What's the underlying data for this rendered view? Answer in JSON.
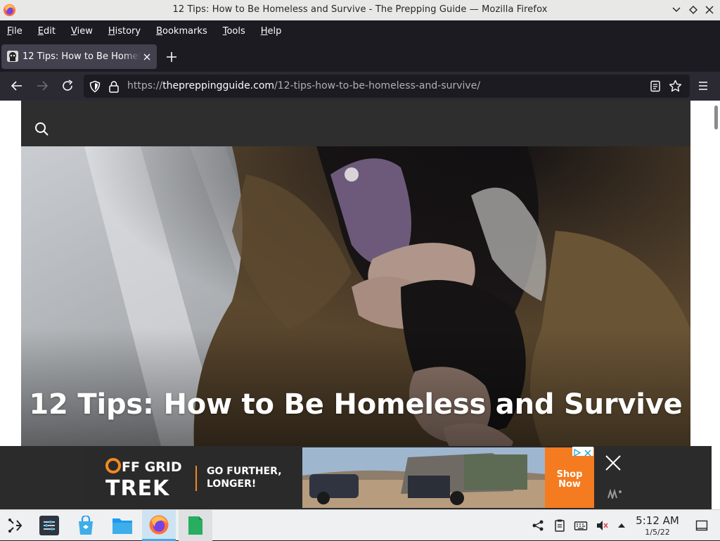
{
  "window": {
    "title": "12 Tips: How to Be Homeless and Survive - The Prepping Guide — Mozilla Firefox"
  },
  "menubar": {
    "items": [
      "File",
      "Edit",
      "View",
      "History",
      "Bookmarks",
      "Tools",
      "Help"
    ]
  },
  "tab": {
    "title": "12 Tips: How to Be Homeless and Survive - The Prepping Guide"
  },
  "urlbar": {
    "scheme": "https://",
    "domain": "thepreppingguide.com",
    "path": "/12-tips-how-to-be-homeless-and-survive/"
  },
  "page": {
    "hero_title": "12 Tips: How to Be Homeless and Survive"
  },
  "ad": {
    "brand_line1": "OFF GRID",
    "brand_line2": "TREK",
    "tagline_line1": "GO FURTHER,",
    "tagline_line2": "LONGER!",
    "cta_line1": "Shop",
    "cta_line2": "Now"
  },
  "taskbar": {
    "time": "5:12 AM",
    "date": "1/5/22"
  },
  "colors": {
    "chrome_dark": "#1c1b22",
    "navbar": "#2b2a33",
    "ad_accent": "#f47b20",
    "taskbar_active": "#3daee9"
  }
}
